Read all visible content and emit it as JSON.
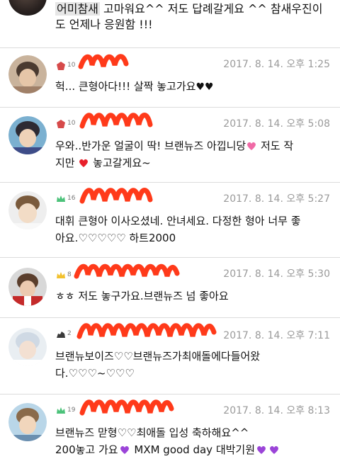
{
  "top": {
    "highlight": "어미참새",
    "text_line1": " 고마워요^^ 저도 답례갈게요 ^^ 참새우진이",
    "text_line2": "도 언제나 응원함 !!!"
  },
  "comments": [
    {
      "level": "10",
      "timestamp": "2017. 8. 14. 오후 1:25",
      "line1": "헉... 큰형아다!!! 살짝 놓고가요",
      "hearts1": "♥♥",
      "badge_color": "#d64a4a",
      "avatar_icon": "avatar-icon"
    },
    {
      "level": "10",
      "timestamp": "2017. 8. 14. 오후 5:08",
      "line1": "우와..반가운 얼굴이 딱! 브랜뉴즈 아낍니당",
      "line1_after": " 저도 작",
      "line2_pre": "지만 ",
      "line2_after": " 놓고갈게요~",
      "badge_color": "#d64a4a"
    },
    {
      "level": "16",
      "timestamp": "2017. 8. 14. 오후 5:27",
      "line1": "대휘 큰형아 이사오셨네. 안녀세요. 다정한 형아 너무 좋",
      "line2": "아요.♡♡♡♡♡ 하트2000",
      "badge_color": "#4cc27a"
    },
    {
      "level": "8",
      "timestamp": "2017. 8. 14. 오후 5:30",
      "line1": "ㅎㅎ 저도 놓구가요.브랜뉴즈 넘 좋아요",
      "badge_color": "#f2c12e"
    },
    {
      "level": "2",
      "timestamp": "2017. 8. 14. 오후 7:11",
      "line1": "브랜뉴보이즈♡♡브랜뉴즈가최애돌에다들어왔",
      "line2": "다.♡♡♡~♡♡♡",
      "badge_color": "#3a3a3a"
    },
    {
      "level": "19",
      "timestamp": "2017. 8. 14. 오후 8:13",
      "line1": "브랜뉴즈 맏형♡♡최애돌 입성 축하해요^^",
      "line2_pre": "200놓고 가요",
      "line2_mid": " MXM good day 대박기원",
      "badge_color": "#4cc27a"
    }
  ]
}
